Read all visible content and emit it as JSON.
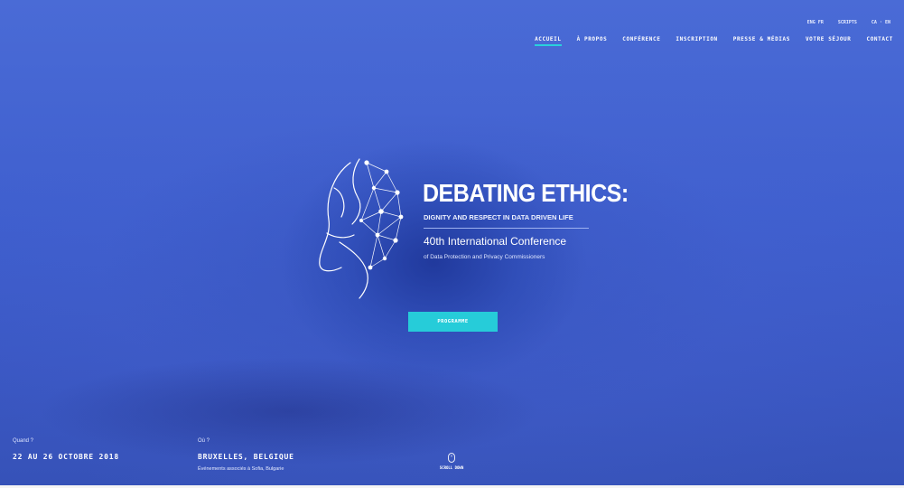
{
  "language_menu": [
    "ENG FR",
    "SCRIPTS",
    "CA · EN"
  ],
  "nav": {
    "items": [
      "ACCUEIL",
      "À PROPOS",
      "CONFÉRENCE",
      "INSCRIPTION",
      "PRESSE & MÉDIAS",
      "VOTRE SÉJOUR",
      "CONTACT"
    ],
    "active_index": 0
  },
  "hero": {
    "title": "DEBATING ETHICS:",
    "subtitle": "DIGNITY AND RESPECT IN DATA DRIVEN LIFE",
    "conference": "40th International Conference",
    "conference_sub": "of Data Protection and Privacy Commissioners",
    "cta_label": "PROGRAMME"
  },
  "info": {
    "when_label": "Quand ?",
    "when_value": "22 AU 26 OCTOBRE 2018",
    "where_label": "Où ?",
    "where_value": "BRUXELLES, BELGIQUE",
    "where_address": "Événements associés à Sofia, Bulgarie"
  },
  "scroll_label": "SCROLL DOWN",
  "colors": {
    "accent": "#26ccd9",
    "hero_blue": "#3f5fce",
    "text": "#ffffff"
  },
  "icons": [
    "brain-network-logo-icon",
    "mouse-scroll-icon"
  ]
}
